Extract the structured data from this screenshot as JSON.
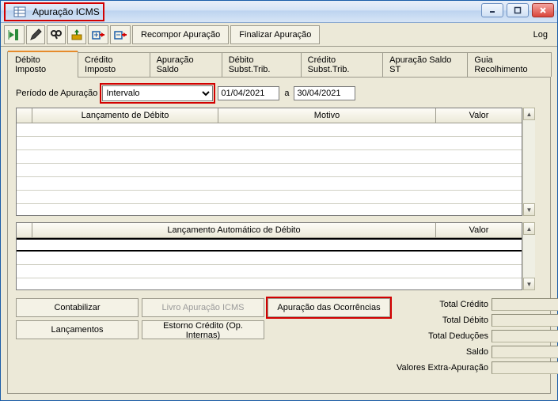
{
  "window": {
    "title": "Apuração ICMS"
  },
  "toolbar": {
    "recompor": "Recompor Apuração",
    "finalizar": "Finalizar Apuração",
    "log": "Log"
  },
  "tabs": [
    "Débito Imposto",
    "Crédito Imposto",
    "Apuração Saldo",
    "Débito Subst.Trib.",
    "Crédito Subst.Trib.",
    "Apuração Saldo ST",
    "Guia Recolhimento"
  ],
  "period": {
    "label": "Período de  Apuração",
    "mode": "Intervalo",
    "from": "01/04/2021",
    "sep": "a",
    "to": "30/04/2021"
  },
  "grid1": {
    "cols": [
      "Lançamento de Débito",
      "Motivo",
      "Valor"
    ]
  },
  "grid2": {
    "cols": [
      "Lançamento Automático de Débito",
      "Valor"
    ]
  },
  "buttons": {
    "contabilizar": "Contabilizar",
    "livro": "Livro Apuração ICMS",
    "ocorrencias": "Apuração das Ocorrências",
    "lancamentos": "Lançamentos",
    "estorno": "Estorno Crédito (Op. Internas)"
  },
  "totals": {
    "credito": "Total Crédito",
    "debito": "Total Débito",
    "deducoes": "Total Deduções",
    "saldo": "Saldo",
    "extra": "Valores Extra-Apuração"
  }
}
